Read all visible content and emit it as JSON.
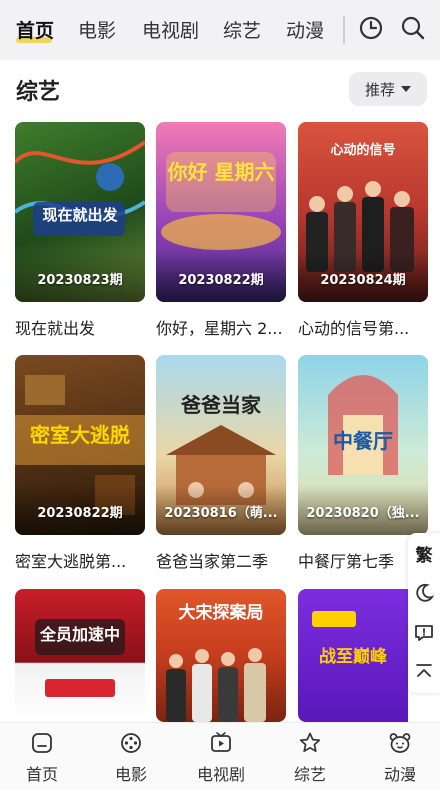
{
  "top_tabs": [
    {
      "label": "首页",
      "active": true
    },
    {
      "label": "电影",
      "active": false
    },
    {
      "label": "电视剧",
      "active": false
    },
    {
      "label": "综艺",
      "active": false
    },
    {
      "label": "动漫",
      "active": false
    }
  ],
  "top_icons": [
    "history-clock-icon",
    "search-icon"
  ],
  "section": {
    "title": "综艺",
    "sort_label": "推荐"
  },
  "cards": [
    {
      "episode": "20230823期",
      "caption": "现在就出发",
      "poster_text": "现在就出发"
    },
    {
      "episode": "20230822期",
      "caption": "你好，星期六 2...",
      "poster_text": "你好 星期六"
    },
    {
      "episode": "20230824期",
      "caption": "心动的信号第...",
      "poster_text": "心动的信号"
    },
    {
      "episode": "20230822期",
      "caption": "密室大逃脱第...",
      "poster_text": "密室大逃脱"
    },
    {
      "episode": "20230816（萌...",
      "caption": "爸爸当家第二季",
      "poster_text": "爸爸当家"
    },
    {
      "episode": "20230820（独...",
      "caption": "中餐厅第七季",
      "poster_text": "中餐厅"
    },
    {
      "episode": "",
      "caption": "",
      "poster_text": "全员加速中"
    },
    {
      "episode": "",
      "caption": "",
      "poster_text": "大宋探案局"
    },
    {
      "episode": "",
      "caption": "",
      "poster_text": "战至巅峰"
    }
  ],
  "float_panel": {
    "traditional_label": "繁",
    "icons": [
      "moon-icon",
      "message-icon",
      "back-to-top-icon"
    ]
  },
  "bottom_nav": [
    {
      "label": "首页",
      "icon": "home-tv-icon"
    },
    {
      "label": "电影",
      "icon": "film-reel-icon"
    },
    {
      "label": "电视剧",
      "icon": "tv-play-icon"
    },
    {
      "label": "综艺",
      "icon": "star-icon"
    },
    {
      "label": "动漫",
      "icon": "bear-icon"
    }
  ],
  "colors": {
    "accent_underline": "#f3d046",
    "nav_bg": "#f2f2f4"
  }
}
